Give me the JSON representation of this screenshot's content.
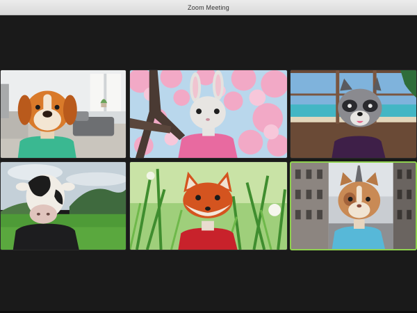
{
  "window": {
    "title": "Zoom Meeting"
  },
  "participants": [
    {
      "avatar": "dog-avatar",
      "background": "living-room",
      "shirt": "#3ab891",
      "active": false
    },
    {
      "avatar": "bunny-avatar",
      "background": "cherry-blossom",
      "shirt": "#e86aa0",
      "active": false
    },
    {
      "avatar": "raccoon-avatar",
      "background": "beach-window",
      "shirt": "#3e1f48",
      "active": false
    },
    {
      "avatar": "cow-avatar",
      "background": "green-hills",
      "shirt": "#1d1d1f",
      "active": false
    },
    {
      "avatar": "fox-avatar",
      "background": "grass-meadow",
      "shirt": "#c8222b",
      "active": false
    },
    {
      "avatar": "cat-avatar",
      "background": "paris-street",
      "shirt": "#57b8d8",
      "active": true
    }
  ],
  "colors": {
    "active_speaker_border": "#8fd14f",
    "stage_background": "#1a1a1a"
  }
}
